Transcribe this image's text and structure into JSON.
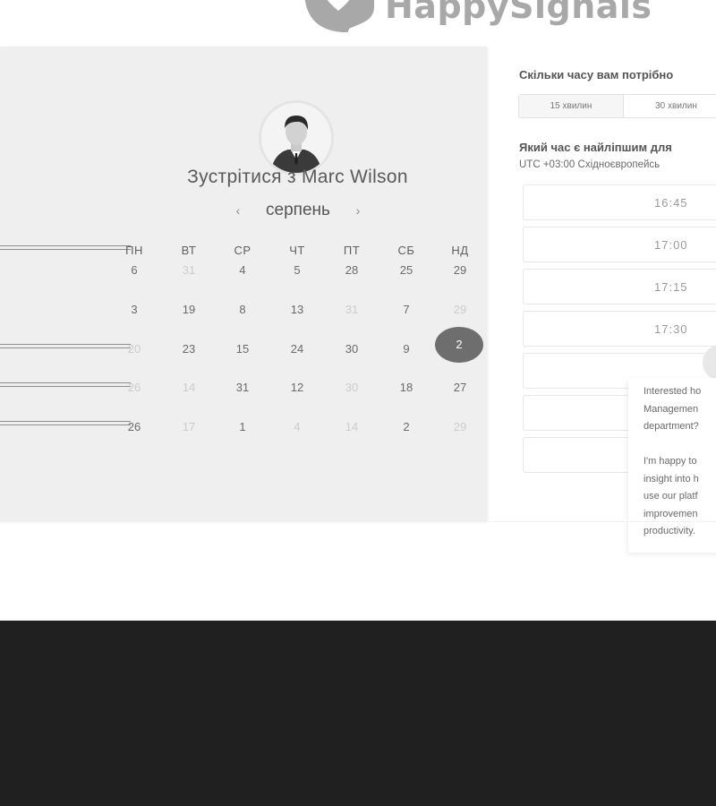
{
  "brand": {
    "name": "HappySignals"
  },
  "calendar": {
    "title": "Зустрітися з Marc Wilson",
    "month": "серпень",
    "prev_icon": "chevron-left-icon",
    "next_icon": "chevron-right-icon",
    "weekdays": [
      "ПН",
      "ВТ",
      "СР",
      "ЧТ",
      "ПТ",
      "СБ",
      "НД"
    ],
    "weeks": [
      [
        "6",
        "31",
        "4",
        "5",
        "28",
        "25",
        "29"
      ],
      [
        "3",
        "19",
        "8",
        "13",
        "31",
        "7",
        "29"
      ],
      [
        "20",
        "23",
        "15",
        "24",
        "30",
        "9",
        "2"
      ],
      [
        "26",
        "14",
        "31",
        "12",
        "30",
        "18",
        "27"
      ],
      [
        "26",
        "17",
        "1",
        "4",
        "14",
        "2",
        "29"
      ]
    ],
    "faded": [
      [
        false,
        true,
        false,
        false,
        false,
        false,
        false
      ],
      [
        false,
        false,
        false,
        false,
        true,
        false,
        true
      ],
      [
        true,
        false,
        false,
        false,
        false,
        false,
        false
      ],
      [
        true,
        true,
        false,
        false,
        true,
        false,
        false
      ],
      [
        false,
        true,
        false,
        true,
        true,
        false,
        true
      ]
    ],
    "selected_day": "2"
  },
  "booking": {
    "duration_question": "Скільки часу вам потрібно",
    "durations": [
      "15 хвилин",
      "30 хвилин"
    ],
    "time_question": "Який час є найліпшим для",
    "timezone": "UTC +03:00 Східноєвропейсь",
    "slots": [
      "16:45",
      "17:00",
      "17:15",
      "17:30"
    ]
  },
  "chat": {
    "lines_1": [
      "Interested ho",
      "Managemen",
      "department?"
    ],
    "lines_2": [
      "I'm happy to",
      "insight into h",
      "use our platf",
      "improvemen",
      "productivity."
    ]
  },
  "colors": {
    "footer": "#202020",
    "panel": "#efefef",
    "selected": "#6e6e6e"
  }
}
